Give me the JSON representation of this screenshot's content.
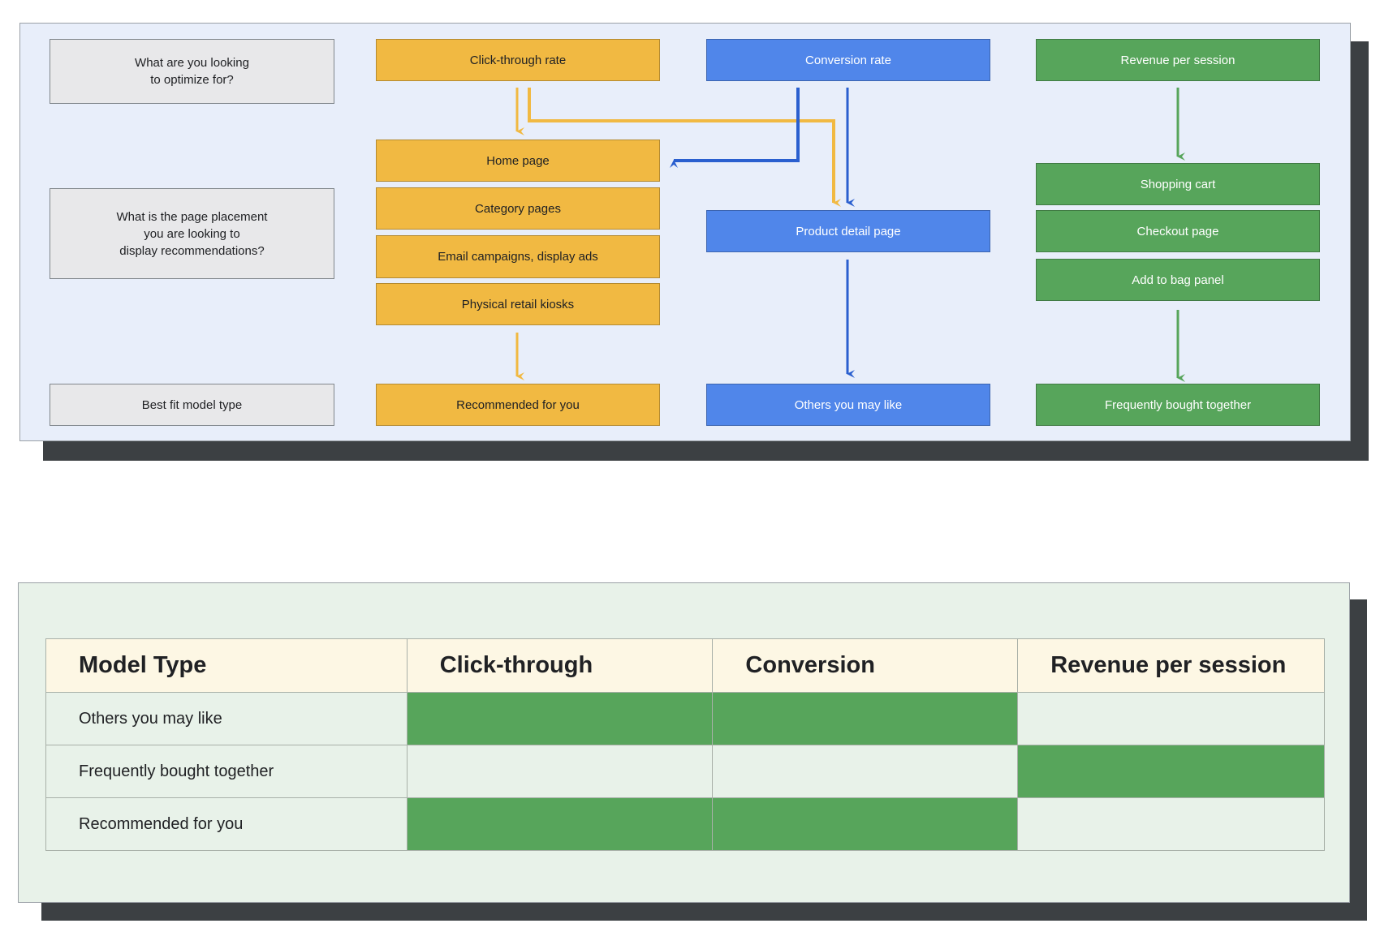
{
  "flow": {
    "row_labels": [
      "What are you looking\nto optimize for?",
      "What is the page placement\nyou are looking to\ndisplay recommendations?",
      "Best fit model type"
    ],
    "goals": [
      "Click-through rate",
      "Conversion rate",
      "Revenue per session"
    ],
    "placements_ctr": [
      "Home page",
      "Category pages",
      "Email campaigns, display ads",
      "Physical retail kiosks"
    ],
    "placements_conversion": [
      "Product detail page"
    ],
    "placements_revenue": [
      "Shopping cart",
      "Checkout page",
      "Add to bag panel"
    ],
    "models": [
      "Recommended for you",
      "Others you may like",
      "Frequently bought together"
    ],
    "colors": {
      "ctr": "#f1b942",
      "conversion": "#5086ea",
      "revenue": "#57a55b",
      "label": "#e8e8ea"
    }
  },
  "table": {
    "headers": [
      "Model Type",
      "Click-through",
      "Conversion",
      "Revenue per session"
    ],
    "rows": [
      {
        "label": "Others you may like",
        "fit": [
          true,
          true,
          false
        ]
      },
      {
        "label": "Frequently bought together",
        "fit": [
          false,
          false,
          true
        ]
      },
      {
        "label": "Recommended for you",
        "fit": [
          true,
          true,
          false
        ]
      }
    ],
    "highlight_color": "#57a55b"
  }
}
